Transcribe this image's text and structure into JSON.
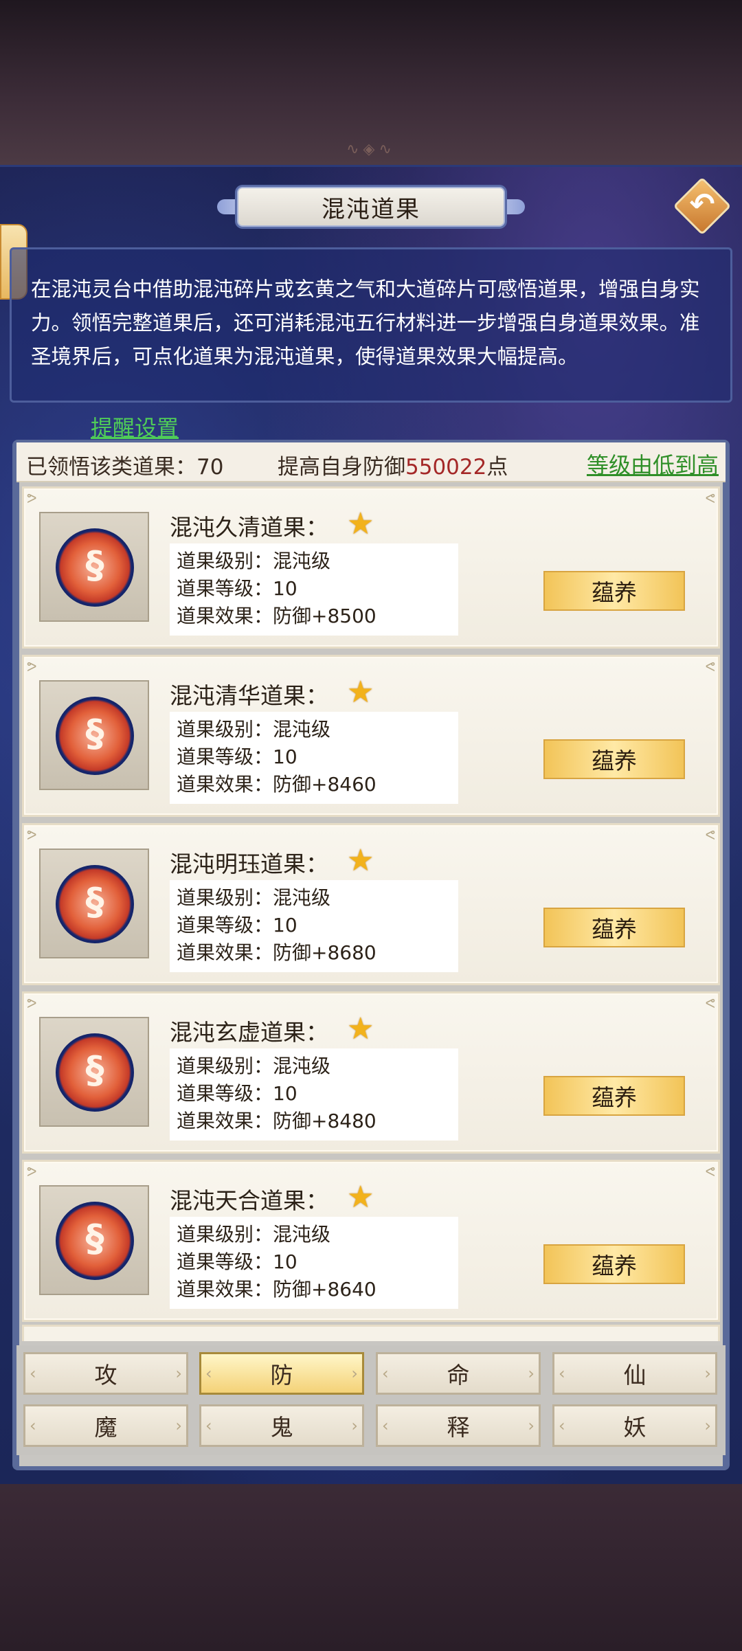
{
  "header": {
    "title": "混沌道果",
    "back_label": "↶"
  },
  "description": "在混沌灵台中借助混沌碎片或玄黄之气和大道碎片可感悟道果，增强自身实力。领悟完整道果后，还可消耗混沌五行材料进一步增强自身道果效果。准圣境界后，可点化道果为混沌道果，使得道果效果大幅提高。",
  "reminder_label": "提醒设置",
  "stats": {
    "learned_label": "已领悟该类道果：",
    "learned_count": "70",
    "boost_prefix": "提高自身防御",
    "boost_value": "550022",
    "boost_suffix": "点",
    "sort_label": "等级由低到高"
  },
  "cards": [
    {
      "name": "混沌久清道果：",
      "rank": "道果级别：混沌级",
      "level": "道果等级：10",
      "effect": "道果效果：防御+8500",
      "button": "蕴养"
    },
    {
      "name": "混沌清华道果：",
      "rank": "道果级别：混沌级",
      "level": "道果等级：10",
      "effect": "道果效果：防御+8460",
      "button": "蕴养"
    },
    {
      "name": "混沌明珏道果：",
      "rank": "道果级别：混沌级",
      "level": "道果等级：10",
      "effect": "道果效果：防御+8680",
      "button": "蕴养"
    },
    {
      "name": "混沌玄虚道果：",
      "rank": "道果级别：混沌级",
      "level": "道果等级：10",
      "effect": "道果效果：防御+8480",
      "button": "蕴养"
    },
    {
      "name": "混沌天合道果：",
      "rank": "道果级别：混沌级",
      "level": "道果等级：10",
      "effect": "道果效果：防御+8640",
      "button": "蕴养"
    }
  ],
  "tabs": [
    "攻",
    "防",
    "命",
    "仙",
    "魔",
    "鬼",
    "释",
    "妖"
  ],
  "active_tab": "防",
  "colors": {
    "accent_green": "#2f8f28",
    "value_red": "#a42828",
    "button_gold": "#f2c458",
    "star": "#f2b21c"
  }
}
